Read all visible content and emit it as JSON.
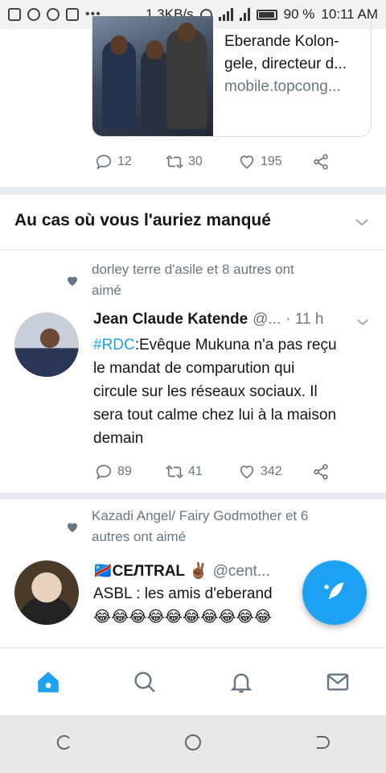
{
  "status_bar": {
    "speed": "1.3KB/s",
    "battery": "90 %",
    "time": "10:11 AM"
  },
  "link_card": {
    "title_line1": "Eberande Kolon-",
    "title_line2": "gele, directeur d...",
    "domain": "mobile.topcong..."
  },
  "top_actions": {
    "replies": "12",
    "retweets": "30",
    "likes": "195"
  },
  "section": {
    "title": "Au cas où vous l'auriez manqué"
  },
  "tweet1": {
    "context_line1": "dorley terre d'asile et 8 autres ont",
    "context_line2": "aimé",
    "name": "Jean Claude Katende",
    "handle": "@...",
    "time": "· 11 h",
    "hashtag": "#RDC",
    "text_line1": ":Evêque Mukuna n'a pas reçu",
    "text_line2": "le mandat de comparution qui",
    "text_line3": "circule sur les réseaux sociaux. Il",
    "text_line4": "sera tout calme chez lui à la maison",
    "text_line5": "demain",
    "replies": "89",
    "retweets": "41",
    "likes": "342"
  },
  "tweet2": {
    "context_line1": "Kazadi Angel/ Fairy Godmother et 6",
    "context_line2": "autres ont aimé",
    "name": "🇨🇩CEЛTRAL ✌🏾",
    "handle": "@cent...",
    "text_line1": "ASBL : les amis d'eberand",
    "text_line2": "😂😂😂😂😂😂😂😂😂😂"
  },
  "icons": {
    "reply": "reply-icon",
    "retweet": "retweet-icon",
    "like": "heart-icon",
    "share": "share-icon",
    "compose": "compose-icon",
    "home": "home-icon",
    "search": "search-icon",
    "notifications": "bell-icon",
    "messages": "envelope-icon"
  },
  "colors": {
    "accent": "#1da1f2",
    "muted": "#657786",
    "text": "#14171a"
  }
}
